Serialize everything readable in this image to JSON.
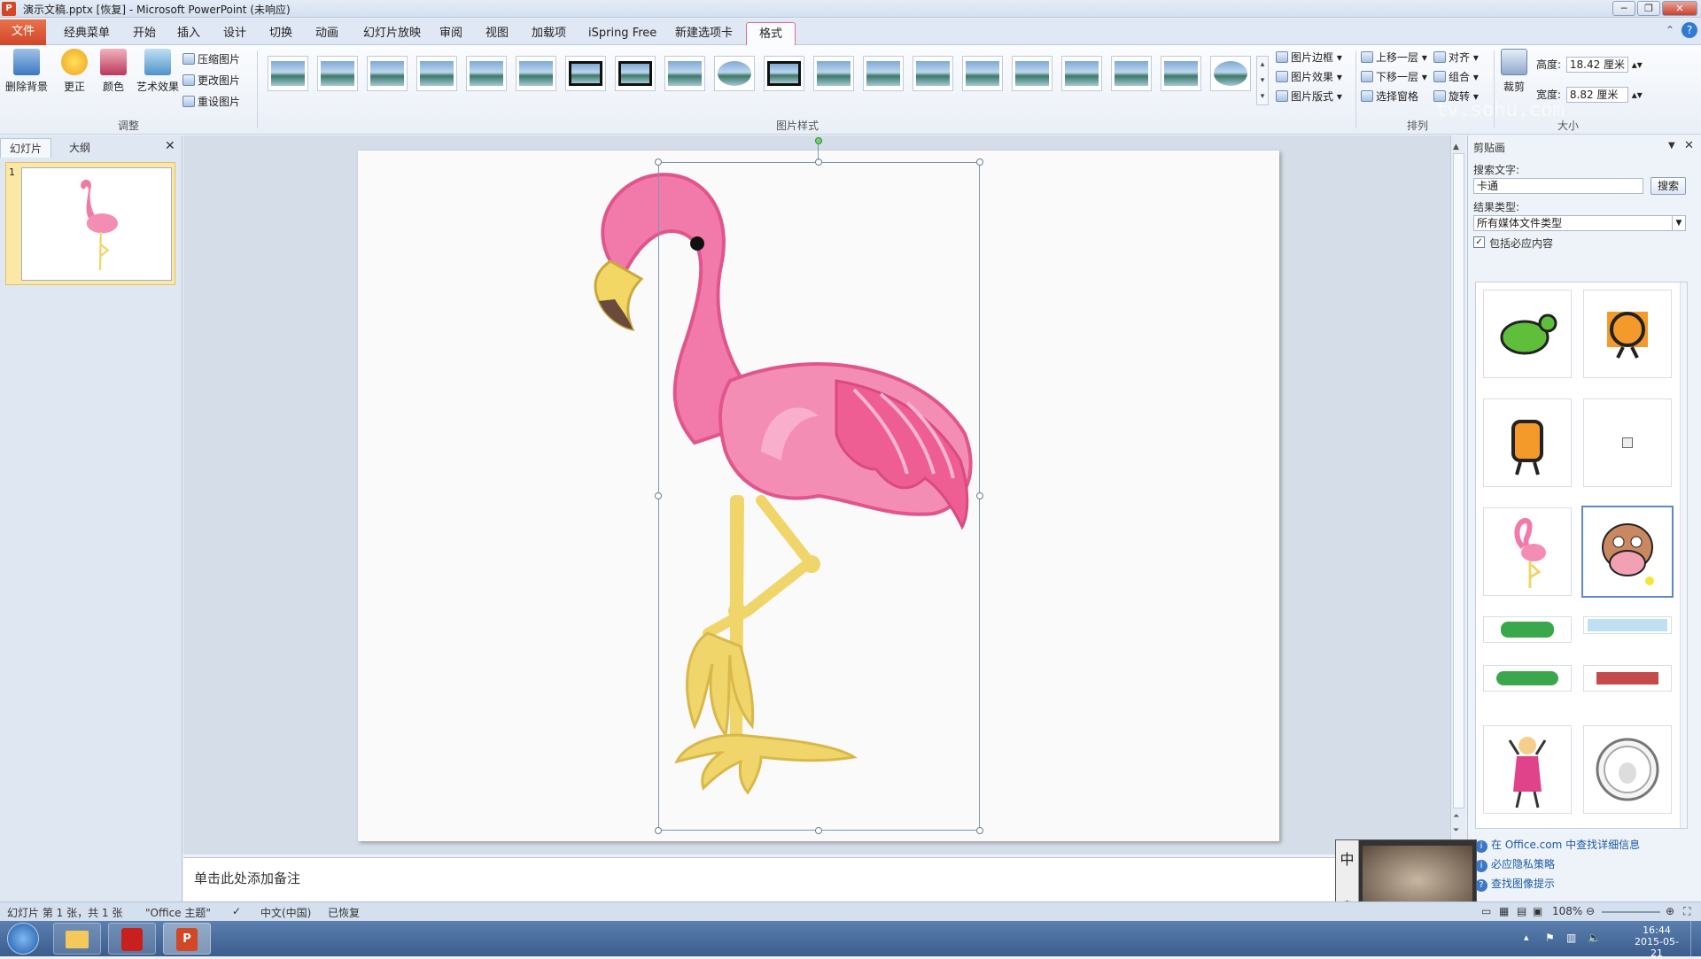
{
  "window": {
    "title": "演示文稿.pptx [恢复] - Microsoft PowerPoint (未响应)",
    "controls": [
      "─",
      "❐",
      "✕"
    ]
  },
  "tabs": [
    "文件",
    "经典菜单",
    "开始",
    "插入",
    "设计",
    "切换",
    "动画",
    "幻灯片放映",
    "审阅",
    "视图",
    "加载项",
    "iSpring Free",
    "新建选项卡",
    "格式"
  ],
  "ribbon": {
    "adjust": {
      "remove_bg": "删除背景",
      "corrections": "更正",
      "color": "颜色",
      "artistic": "艺术效果",
      "compress": "压缩图片",
      "change": "更改图片",
      "reset": "重设图片",
      "group_label": "调整"
    },
    "styles_label": "图片样式",
    "style_cmds": [
      "图片边框",
      "图片效果",
      "图片版式"
    ],
    "arrange": {
      "bring_forward": "上移一层",
      "send_backward": "下移一层",
      "selection_pane": "选择窗格",
      "align": "对齐",
      "group": "组合",
      "rotate": "旋转",
      "label": "排列"
    },
    "size": {
      "crop": "裁剪",
      "height_label": "高度:",
      "height": "18.42 厘米",
      "width_label": "宽度:",
      "width": "8.82 厘米",
      "label": "大小"
    }
  },
  "left_pane": {
    "tab_slides": "幻灯片",
    "tab_outline": "大纲",
    "slide_num": "1"
  },
  "notes_placeholder": "单击此处添加备注",
  "clip_pane": {
    "title": "剪贴画",
    "search_label": "搜索文字:",
    "search_value": "卡通",
    "search_button": "搜索",
    "results_label": "结果类型:",
    "results_value": "所有媒体文件类型",
    "include_label": "包括必应内容",
    "links": [
      "在 Office.com 中查找详细信息",
      "必应隐私策略",
      "查找图像提示"
    ]
  },
  "status": {
    "slide": "幻灯片 第 1 张，共 1 张",
    "theme": "\"Office 主题\"",
    "lang": "中文(中国)",
    "recovered": "已恢复",
    "zoom": "108%"
  },
  "clock": {
    "time": "16:44",
    "date": "2015-05-21"
  },
  "ime": {
    "char": "中"
  },
  "watermark": "tv.sohu.com"
}
